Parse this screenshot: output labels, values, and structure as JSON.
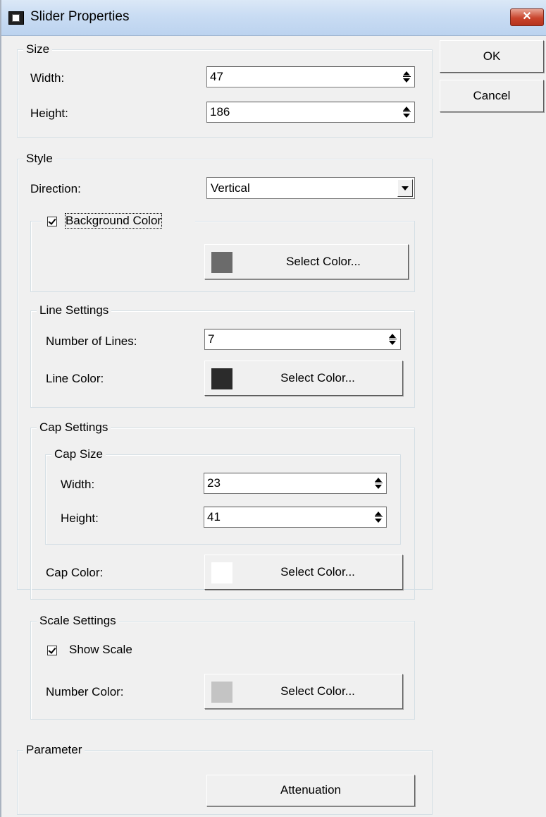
{
  "window": {
    "title": "Slider Properties",
    "close_glyph": "✕"
  },
  "buttons": {
    "ok": "OK",
    "cancel": "Cancel"
  },
  "size_group": {
    "legend": "Size",
    "width_label": "Width:",
    "width_value": "47",
    "height_label": "Height:",
    "height_value": "186"
  },
  "style_group": {
    "legend": "Style",
    "direction_label": "Direction:",
    "direction_value": "Vertical",
    "background": {
      "label": "Background Color",
      "checked": true,
      "button": "Select Color...",
      "color": "#6b6b6b"
    },
    "line_settings": {
      "legend": "Line Settings",
      "num_lines_label": "Number of Lines:",
      "num_lines_value": "7",
      "line_color_label": "Line Color:",
      "button": "Select Color...",
      "color": "#2b2b2b"
    },
    "cap_settings": {
      "legend": "Cap Settings",
      "cap_size_legend": "Cap Size",
      "width_label": "Width:",
      "width_value": "23",
      "height_label": "Height:",
      "height_value": "41",
      "cap_color_label": "Cap Color:",
      "button": "Select Color...",
      "color": "#ffffff"
    },
    "scale_settings": {
      "legend": "Scale Settings",
      "show_scale_label": "Show Scale",
      "show_scale_checked": true,
      "number_color_label": "Number Color:",
      "button": "Select Color...",
      "color": "#c4c4c4"
    }
  },
  "parameter_group": {
    "legend": "Parameter",
    "button": "Attenuation"
  }
}
